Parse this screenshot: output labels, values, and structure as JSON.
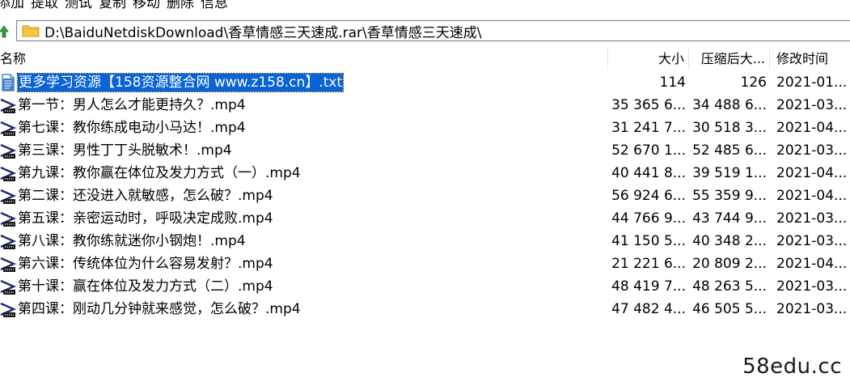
{
  "toolbar": {
    "items": [
      "添加",
      "提取",
      "测试",
      "复制",
      "移动",
      "删除",
      "信息"
    ]
  },
  "address": {
    "path": "D:\\BaiduNetdiskDownload\\香草情感三天速成.rar\\香草情感三天速成\\"
  },
  "columns": {
    "name": "名称",
    "size": "大小",
    "packed": "压缩后大...",
    "modified": "修改时间"
  },
  "files": [
    {
      "name": "更多学习资源【158资源整合网 www.z158.cn】.txt",
      "size": "114",
      "packed": "126",
      "modified": "2021-01...",
      "type": "txt",
      "selected": true
    },
    {
      "name": "第一节：男人怎么才能更持久？.mp4",
      "size": "35 365 6...",
      "packed": "34 488 6...",
      "modified": "2021-03...",
      "type": "video"
    },
    {
      "name": "第七课：教你练成电动小马达！.mp4",
      "size": "31 241 7...",
      "packed": "30 518 3...",
      "modified": "2021-04...",
      "type": "video"
    },
    {
      "name": "第三课：男性丁丁头脱敏术！.mp4",
      "size": "52 670 1...",
      "packed": "52 485 6...",
      "modified": "2021-03...",
      "type": "video"
    },
    {
      "name": "第九课：教你赢在体位及发力方式（一）.mp4",
      "size": "40 441 8...",
      "packed": "39 519 1...",
      "modified": "2021-04...",
      "type": "video"
    },
    {
      "name": "第二课：还没进入就敏感，怎么破？.mp4",
      "size": "56 924 6...",
      "packed": "55 359 9...",
      "modified": "2021-04...",
      "type": "video"
    },
    {
      "name": "第五课：亲密运动时，呼吸决定成败.mp4",
      "size": "44 766 9...",
      "packed": "43 744 9...",
      "modified": "2021-03...",
      "type": "video"
    },
    {
      "name": "第八课：教你练就迷你小钢炮！.mp4",
      "size": "41 150 5...",
      "packed": "40 348 2...",
      "modified": "2021-03...",
      "type": "video"
    },
    {
      "name": "第六课：传统体位为什么容易发射？.mp4",
      "size": "21 221 6...",
      "packed": "20 809 2...",
      "modified": "2021-04...",
      "type": "video"
    },
    {
      "name": "第十课：赢在体位及发力方式（二）.mp4",
      "size": "48 419 7...",
      "packed": "48 263 5...",
      "modified": "2021-03...",
      "type": "video"
    },
    {
      "name": "第四课：刚动几分钟就来感觉，怎么破？.mp4",
      "size": "47 482 4...",
      "packed": "46 505 5...",
      "modified": "2021-03...",
      "type": "video"
    }
  ],
  "watermark": "58edu.cc",
  "colors": {
    "selection": "#0a64d8",
    "folder": "#f5c542"
  }
}
